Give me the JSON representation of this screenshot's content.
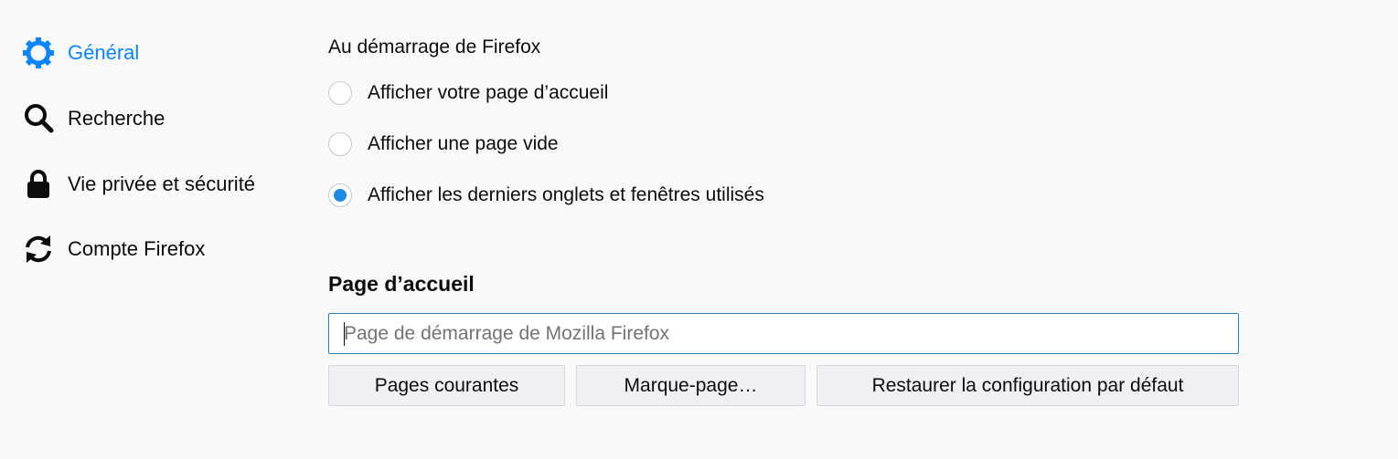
{
  "sidebar": {
    "items": [
      {
        "label": "Général",
        "icon": "gear-icon",
        "selected": true
      },
      {
        "label": "Recherche",
        "icon": "search-icon",
        "selected": false
      },
      {
        "label": "Vie privée et sécurité",
        "icon": "lock-icon",
        "selected": false
      },
      {
        "label": "Compte Firefox",
        "icon": "sync-icon",
        "selected": false
      }
    ]
  },
  "startup": {
    "label": "Au démarrage de Firefox",
    "options": [
      {
        "label": "Afficher votre page d’accueil",
        "checked": false
      },
      {
        "label": "Afficher une page vide",
        "checked": false
      },
      {
        "label": "Afficher les derniers onglets et fenêtres utilisés",
        "checked": true
      }
    ]
  },
  "homepage": {
    "title": "Page d’accueil",
    "input_placeholder": "Page de démarrage de Mozilla Firefox",
    "input_value": "",
    "buttons": {
      "current_pages": "Pages courantes",
      "bookmark": "Marque-page…",
      "restore_default": "Restaurer la configuration par défaut"
    }
  },
  "colors": {
    "accent": "#0a84ff",
    "radio_checked": "#1f8ae6",
    "background": "#f9f9f9",
    "input_border_focus": "#2a7fb8"
  }
}
